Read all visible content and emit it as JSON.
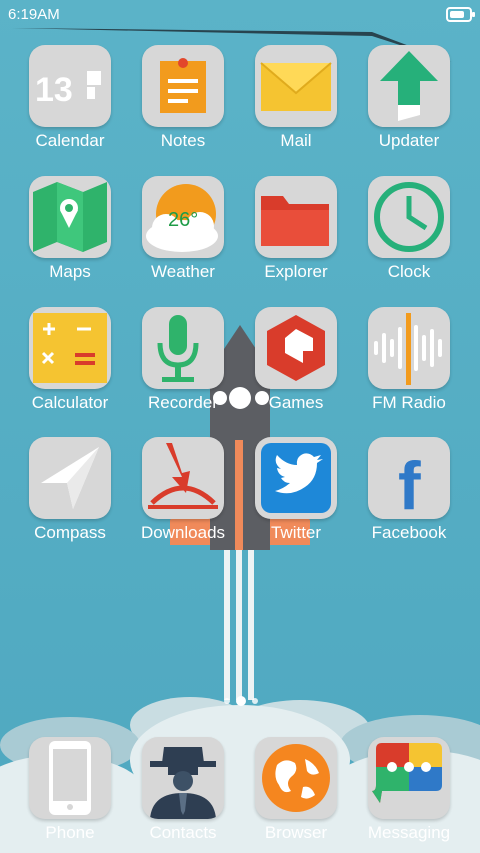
{
  "status": {
    "time": "6:19AM"
  },
  "apps": [
    {
      "id": "calendar",
      "label": "Calendar",
      "icon": "calendar-icon",
      "text": "13"
    },
    {
      "id": "notes",
      "label": "Notes",
      "icon": "notes-icon"
    },
    {
      "id": "mail",
      "label": "Mail",
      "icon": "mail-icon"
    },
    {
      "id": "updater",
      "label": "Updater",
      "icon": "updater-icon"
    },
    {
      "id": "maps",
      "label": "Maps",
      "icon": "maps-icon"
    },
    {
      "id": "weather",
      "label": "Weather",
      "icon": "weather-icon",
      "text": "26°"
    },
    {
      "id": "explorer",
      "label": "Explorer",
      "icon": "folder-icon"
    },
    {
      "id": "clock",
      "label": "Clock",
      "icon": "clock-icon"
    },
    {
      "id": "calculator",
      "label": "Calculator",
      "icon": "calculator-icon"
    },
    {
      "id": "recorder",
      "label": "Recorder",
      "icon": "microphone-icon"
    },
    {
      "id": "games",
      "label": "Games",
      "icon": "games-icon"
    },
    {
      "id": "fm-radio",
      "label": "FM Radio",
      "icon": "radio-wave-icon"
    },
    {
      "id": "compass",
      "label": "Compass",
      "icon": "compass-icon"
    },
    {
      "id": "downloads",
      "label": "Downloads",
      "icon": "download-icon"
    },
    {
      "id": "twitter",
      "label": "Twitter",
      "icon": "twitter-bird-icon"
    },
    {
      "id": "facebook",
      "label": "Facebook",
      "icon": "facebook-icon",
      "text": "f"
    }
  ],
  "dock": [
    {
      "id": "phone",
      "label": "Phone",
      "icon": "phone-icon"
    },
    {
      "id": "contacts",
      "label": "Contacts",
      "icon": "contacts-icon"
    },
    {
      "id": "browser",
      "label": "Browser",
      "icon": "globe-icon"
    },
    {
      "id": "messaging",
      "label": "Messaging",
      "icon": "messaging-icon"
    }
  ],
  "page_indicator": {
    "pages": 3,
    "current": 2
  }
}
